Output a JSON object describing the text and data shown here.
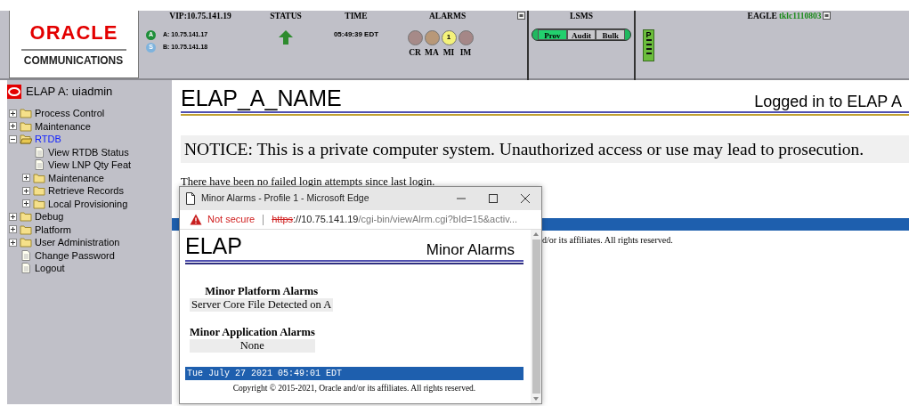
{
  "header": {
    "logo": {
      "brand": "ORACLE",
      "division": "COMMUNICATIONS"
    },
    "vip": {
      "label": "VIP:10.75.141.19",
      "servers": [
        {
          "badge": "A",
          "address": "A: 10.75.141.17",
          "kind": "active"
        },
        {
          "badge": "S",
          "address": "B: 10.75.141.18",
          "kind": "standby"
        }
      ]
    },
    "status": {
      "label": "STATUS",
      "up": true
    },
    "time": {
      "label": "TIME",
      "value": "05:49:39 EDT"
    },
    "alarms": {
      "label": "ALARMS",
      "items": [
        {
          "label": "CR",
          "color": "#a68a88"
        },
        {
          "label": "MA",
          "color": "#b89878"
        },
        {
          "label": "MI",
          "color": "#f4f27a",
          "count": "1"
        },
        {
          "label": "IM",
          "color": "#a58787"
        }
      ]
    },
    "lsms": {
      "label": "LSMS",
      "buttons": [
        {
          "label": "Prov",
          "selected": true
        },
        {
          "label": "Audit",
          "selected": false
        },
        {
          "label": "Bulk",
          "selected": false
        }
      ]
    },
    "eagle": {
      "label": "EAGLE",
      "host": "tklc1110803",
      "card": {
        "label": "P"
      }
    }
  },
  "sidebar": {
    "user": "ELAP A: uiadmin",
    "items": [
      {
        "label": "Process Control",
        "kind": "folder",
        "expanded": false,
        "selected": false
      },
      {
        "label": "Maintenance",
        "kind": "folder",
        "expanded": false,
        "selected": false
      },
      {
        "label": "RTDB",
        "kind": "folder",
        "expanded": true,
        "selected": true,
        "children": [
          {
            "label": "View RTDB Status",
            "kind": "page",
            "selected": false
          },
          {
            "label": "View LNP Qty Feat",
            "kind": "page",
            "selected": false
          },
          {
            "label": "Maintenance",
            "kind": "folder",
            "expanded": false,
            "selected": false
          },
          {
            "label": "Retrieve Records",
            "kind": "folder",
            "expanded": false,
            "selected": false
          },
          {
            "label": "Local Provisioning",
            "kind": "folder",
            "expanded": false,
            "selected": false
          }
        ]
      },
      {
        "label": "Debug",
        "kind": "folder",
        "expanded": false,
        "selected": false
      },
      {
        "label": "Platform",
        "kind": "folder",
        "expanded": false,
        "selected": false
      },
      {
        "label": "User Administration",
        "kind": "folder",
        "expanded": false,
        "selected": false
      },
      {
        "label": "Change Password",
        "kind": "page",
        "selected": false
      },
      {
        "label": "Logout",
        "kind": "page",
        "selected": false
      }
    ]
  },
  "main": {
    "title": "ELAP_A_NAME",
    "login_status": "Logged in to ELAP A",
    "notice": "NOTICE: This is a private computer system. Unauthorized access or use may lead to prosecution.",
    "message": "There have been no failed login attempts since last login.",
    "copyright": "d/or its affiliates. All rights reserved."
  },
  "popup": {
    "window_title": "Minor Alarms - Profile 1 - Microsoft Edge",
    "address": {
      "security": "Not secure",
      "scheme": "https",
      "host": "://10.75.141.19",
      "path": "/cgi-bin/viewAlrm.cgi?bId=15&activ..."
    },
    "page": {
      "title": "ELAP",
      "subtitle": "Minor Alarms",
      "sections": [
        {
          "heading": "Minor Platform Alarms",
          "rows": [
            "Server Core File Detected on A"
          ]
        },
        {
          "heading": "Minor Application Alarms",
          "rows": [
            "None"
          ]
        }
      ],
      "timestamp": "Tue July 27 2021 05:49:01 EDT",
      "copyright": "Copyright © 2015-2021, Oracle and/or its affiliates. All rights reserved."
    }
  }
}
